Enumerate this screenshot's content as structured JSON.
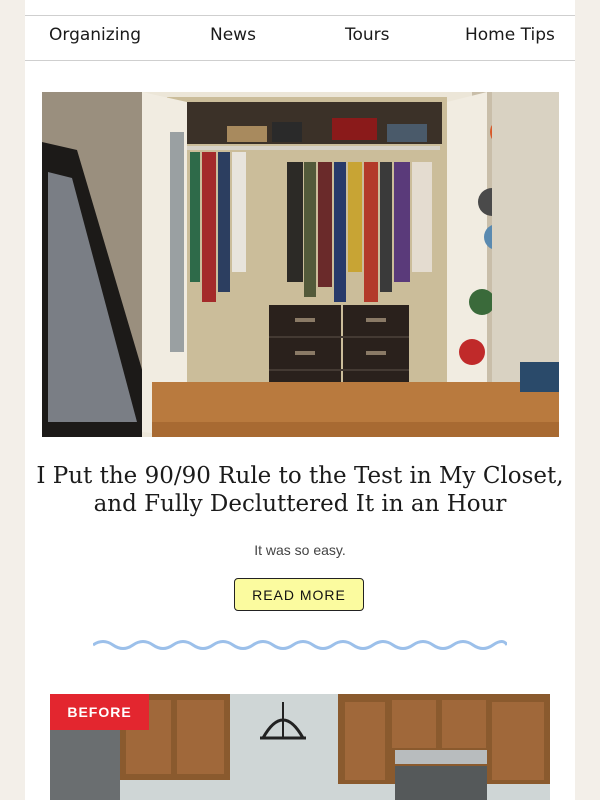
{
  "nav": {
    "items": [
      "Organizing",
      "News",
      "Tours",
      "Home Tips"
    ]
  },
  "article": {
    "headline_line1": "I Put the 90/90 Rule to the Test in My Closet,",
    "headline_line2": "and Fully Decluttered It in an Hour",
    "subtitle": "It was so easy.",
    "cta_label": "READ MORE"
  },
  "next_article": {
    "badge": "BEFORE"
  },
  "colors": {
    "page_bg": "#f3efe9",
    "button_bg": "#fbfb9f",
    "wave": "#9cc0ea",
    "badge_bg": "#e3262f"
  }
}
